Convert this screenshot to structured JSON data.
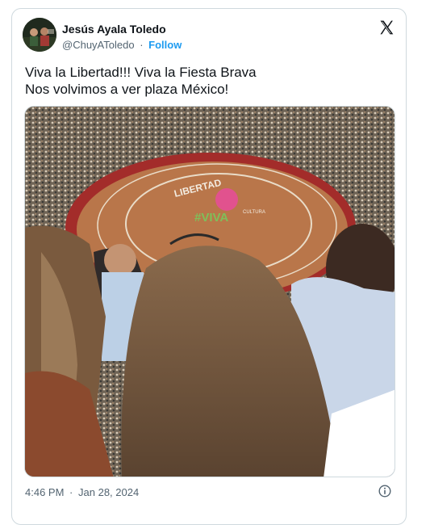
{
  "author": {
    "display_name": "Jesús Ayala Toledo",
    "handle": "@ChuyAToledo",
    "separator": "·",
    "follow_label": "Follow"
  },
  "tweet": {
    "lines": [
      "Viva la Libertad!!! Viva la Fiesta Brava",
      "Nos volvimos a ver plaza México!"
    ],
    "arena_sign_top": "LIBERTAD",
    "arena_sign_mid": "CULTURA",
    "arena_sign_bottom": "#VIVA"
  },
  "meta": {
    "time": "4:46 PM",
    "separator": "·",
    "date": "Jan 28, 2024"
  },
  "icons": {
    "brand": "x-logo-icon",
    "info": "info-icon"
  },
  "colors": {
    "accent": "#1d9bf0",
    "text": "#0f1419",
    "muted": "#536471",
    "border": "#cfd9de",
    "arena": "#b9764a"
  }
}
